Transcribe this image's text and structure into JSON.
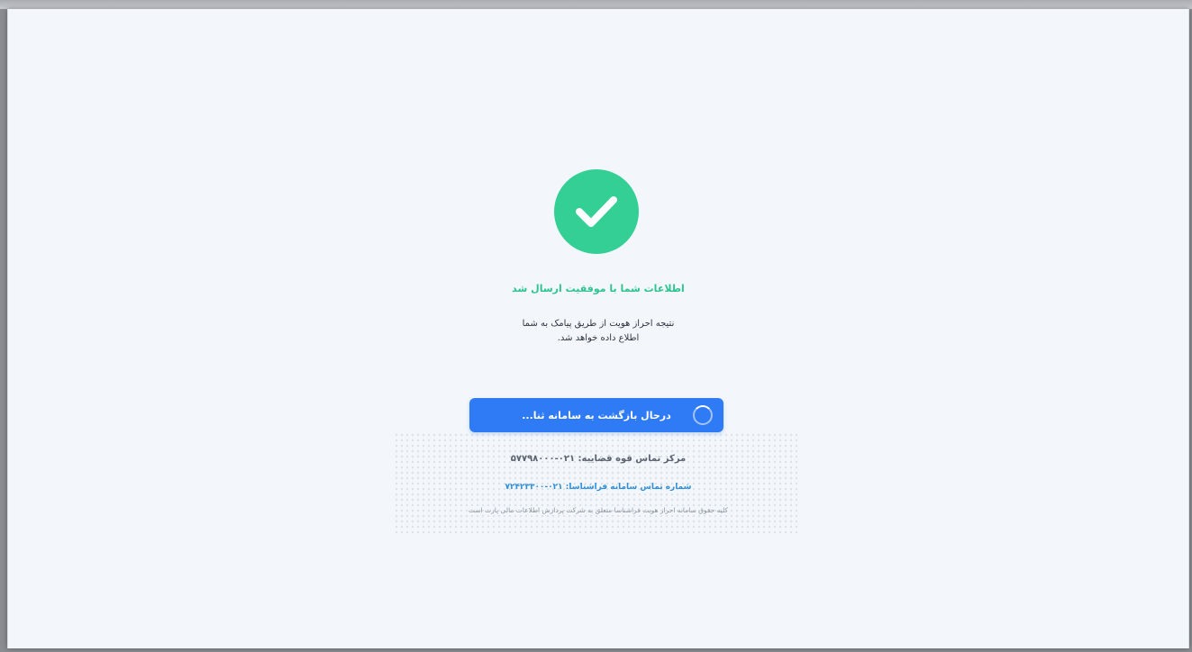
{
  "success": {
    "icon": "check-icon",
    "color": "#33cf95",
    "title": "اطلاعات شما با موفقیت ارسال شد",
    "message_line1": "نتیجه احراز هویت از طریق پیامک به شما",
    "message_line2": "اطلاع داده خواهد شد."
  },
  "action": {
    "label": "درحال بازگشت به سامانه ثنا...",
    "color": "#2f7bf5",
    "icon": "loading-spinner-icon"
  },
  "footer": {
    "judiciary_contact": "مرکز تماس قوه قضاییه: ۰۲۱-۵۷۷۹۸۰۰۰",
    "farashenasa_contact": "شماره تماس سامانه فراشناسا: ۰۲۱-۷۲۴۲۳۳۰۰",
    "copyright": "کلیه حقوق سامانه احراز هویت فراشناسا متعلق به شرکت پردازش اطلاعات مالی پارت است"
  }
}
